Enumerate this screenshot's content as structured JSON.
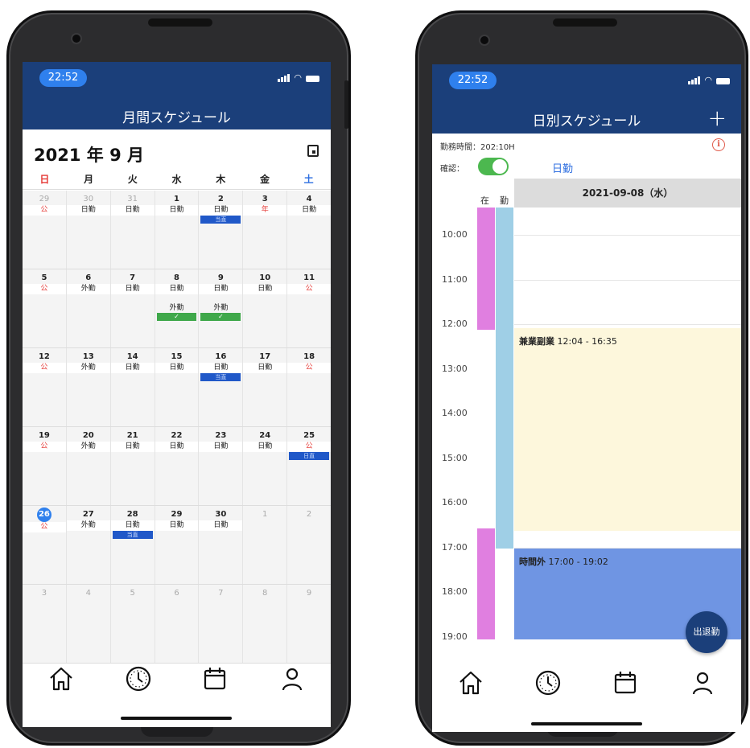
{
  "colors": {
    "header": "#1b3f7a",
    "accent": "#2f80ed",
    "presence_bar": "#e07fe0",
    "work_bar": "#9fcfe6",
    "side_job": "#fdf7dc",
    "overtime": "#6f95e3",
    "confirm_toggle": "#4cb84f"
  },
  "monthly": {
    "status_time": "22:52",
    "header_title": "月間スケジュール",
    "month_label": "2021 年 9 月",
    "weekdays": [
      "日",
      "月",
      "火",
      "水",
      "木",
      "金",
      "土"
    ],
    "weeks": [
      [
        {
          "d": "29",
          "t": "公",
          "red": true,
          "o": true
        },
        {
          "d": "30",
          "t": "日勤",
          "o": true
        },
        {
          "d": "31",
          "t": "日勤",
          "o": true
        },
        {
          "d": "1",
          "t": "日勤"
        },
        {
          "d": "2",
          "t": "日勤",
          "pill": "当直"
        },
        {
          "d": "3",
          "t": "年",
          "red": true
        },
        {
          "d": "4",
          "t": "日勤"
        }
      ],
      [
        {
          "d": "5",
          "t": "公",
          "red": true
        },
        {
          "d": "6",
          "t": "外勤"
        },
        {
          "d": "7",
          "t": "日勤"
        },
        {
          "d": "8",
          "t": "日勤",
          "g": "外勤",
          "check": "✓"
        },
        {
          "d": "9",
          "t": "日勤",
          "g": "外勤",
          "check": "✓"
        },
        {
          "d": "10",
          "t": "日勤"
        },
        {
          "d": "11",
          "t": "公",
          "red": true
        }
      ],
      [
        {
          "d": "12",
          "t": "公",
          "red": true
        },
        {
          "d": "13",
          "t": "外勤"
        },
        {
          "d": "14",
          "t": "日勤"
        },
        {
          "d": "15",
          "t": "日勤"
        },
        {
          "d": "16",
          "t": "日勤",
          "pill": "当直"
        },
        {
          "d": "17",
          "t": "日勤"
        },
        {
          "d": "18",
          "t": "公",
          "red": true
        }
      ],
      [
        {
          "d": "19",
          "t": "公",
          "red": true
        },
        {
          "d": "20",
          "t": "外勤"
        },
        {
          "d": "21",
          "t": "日勤"
        },
        {
          "d": "22",
          "t": "日勤"
        },
        {
          "d": "23",
          "t": "日勤"
        },
        {
          "d": "24",
          "t": "日勤"
        },
        {
          "d": "25",
          "t": "公",
          "red": true,
          "pill": "日直"
        }
      ],
      [
        {
          "d": "26",
          "t": "公",
          "red": true,
          "today": true
        },
        {
          "d": "27",
          "t": "外勤"
        },
        {
          "d": "28",
          "t": "日勤",
          "pill": "当直"
        },
        {
          "d": "29",
          "t": "日勤"
        },
        {
          "d": "30",
          "t": "日勤"
        },
        {
          "d": "1",
          "o": true
        },
        {
          "d": "2",
          "o": true
        }
      ],
      [
        {
          "d": "3",
          "o": true
        },
        {
          "d": "4",
          "o": true
        },
        {
          "d": "5",
          "o": true
        },
        {
          "d": "6",
          "o": true
        },
        {
          "d": "7",
          "o": true
        },
        {
          "d": "8",
          "o": true
        },
        {
          "d": "9",
          "o": true
        }
      ]
    ]
  },
  "daily": {
    "status_time": "22:52",
    "header_title": "日別スケジュール",
    "add_icon": "plus-icon",
    "work_hours": "勤務時間：202:10H",
    "confirm_label": "確認：",
    "confirm_on": true,
    "shift_type": "日勤",
    "col_presence": "在",
    "col_work": "勤",
    "date_label": "2021-09-08（水）",
    "hours": [
      "10:00",
      "11:00",
      "12:00",
      "13:00",
      "14:00",
      "15:00",
      "16:00",
      "17:00",
      "18:00",
      "19:00"
    ],
    "events": [
      {
        "name": "兼業副業",
        "time": "12:04 - 16:35"
      },
      {
        "name": "時間外",
        "time": "17:00 - 19:02"
      }
    ],
    "fab_label": "出退勤"
  },
  "nav": [
    "home-icon",
    "clock-icon",
    "calendar-icon",
    "user-icon"
  ]
}
